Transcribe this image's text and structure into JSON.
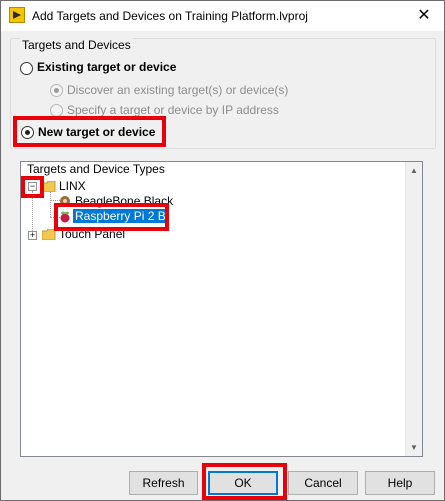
{
  "window": {
    "title": "Add Targets and Devices on Training Platform.lvproj",
    "close_glyph": "✕"
  },
  "group": {
    "legend": "Targets and Devices",
    "options": {
      "existing": "Existing target or device",
      "discover": "Discover an existing target(s) or device(s)",
      "specify": "Specify a target or device by IP address",
      "new": "New target or device"
    }
  },
  "tree": {
    "header": "Targets and Device Types",
    "nodes": [
      {
        "label": "LINX",
        "expanded": true
      },
      {
        "label": "BeagleBone Black"
      },
      {
        "label": "Raspberry Pi 2 B",
        "selected": true
      },
      {
        "label": "Touch Panel",
        "expanded": false
      }
    ]
  },
  "buttons": {
    "refresh": "Refresh",
    "ok": "OK",
    "cancel": "Cancel",
    "help": "Help"
  },
  "colors": {
    "highlight": "#e8000b",
    "selection": "#0078d7"
  },
  "icons": [
    "labview-app-icon",
    "folder-icon",
    "beaglebone-icon",
    "raspberry-pi-icon"
  ]
}
